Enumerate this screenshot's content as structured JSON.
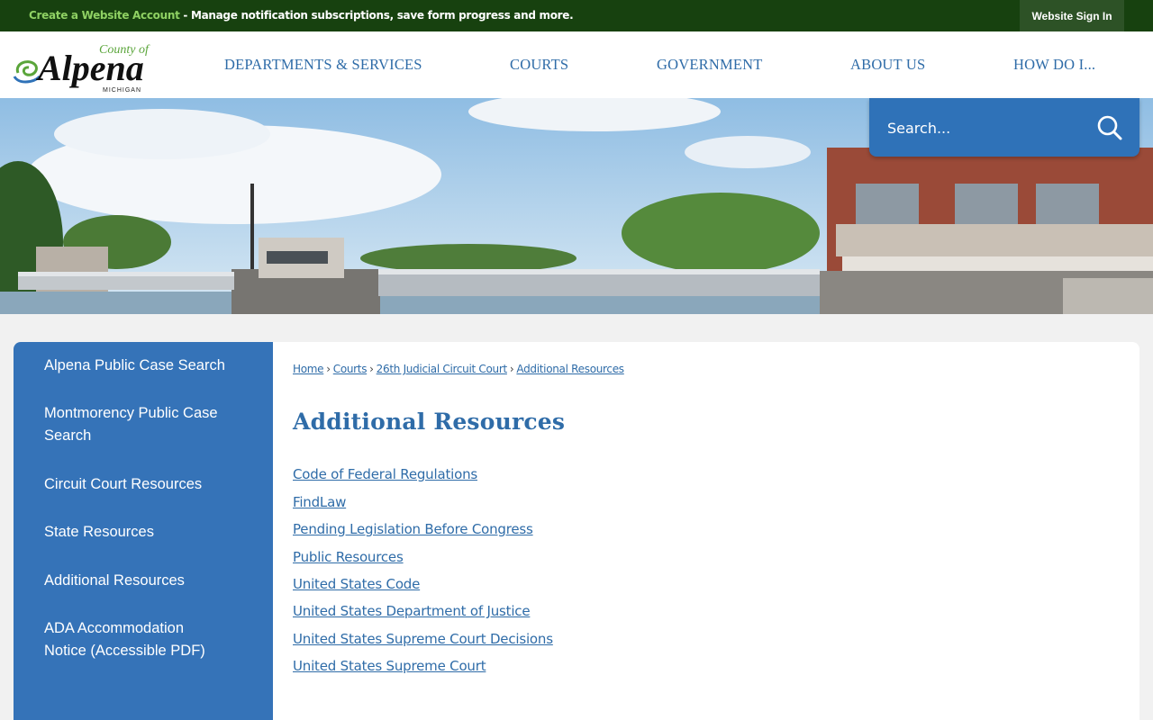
{
  "topbar": {
    "create_account_link": "Create a Website Account",
    "message": " - Manage notification subscriptions, save form progress and more.",
    "sign_in": "Website Sign In"
  },
  "logo": {
    "county_of": "County of",
    "name": "Alpena",
    "state": "MICHIGAN"
  },
  "nav": [
    {
      "label": "DEPARTMENTS & SERVICES"
    },
    {
      "label": "COURTS"
    },
    {
      "label": "GOVERNMENT"
    },
    {
      "label": "ABOUT US"
    },
    {
      "label": "HOW DO I..."
    }
  ],
  "search": {
    "placeholder": "Search..."
  },
  "sidebar": {
    "items": [
      {
        "label": "Alpena Public Case Search"
      },
      {
        "label": "Montmorency Public Case Search"
      },
      {
        "label": "Circuit Court Resources"
      },
      {
        "label": "State Resources"
      },
      {
        "label": "Additional Resources"
      },
      {
        "label": "ADA Accommodation Notice (Accessible PDF)"
      }
    ]
  },
  "breadcrumb": [
    {
      "label": "Home"
    },
    {
      "label": "Courts"
    },
    {
      "label": "26th Judicial Circuit Court"
    },
    {
      "label": "Additional Resources"
    }
  ],
  "main": {
    "title": "Additional Resources",
    "links": [
      {
        "label": "Code of Federal Regulations"
      },
      {
        "label": "FindLaw"
      },
      {
        "label": "Pending Legislation Before Congress"
      },
      {
        "label": "Public Resources"
      },
      {
        "label": "United States Code"
      },
      {
        "label": "United States Department of Justice"
      },
      {
        "label": "United States Supreme Court Decisions"
      },
      {
        "label": "United States Supreme Court"
      }
    ]
  },
  "colors": {
    "topbar": "#17410f",
    "accent_blue": "#2f6ca8",
    "sidebar_blue": "#3573b8",
    "link_green": "#8fd163"
  }
}
